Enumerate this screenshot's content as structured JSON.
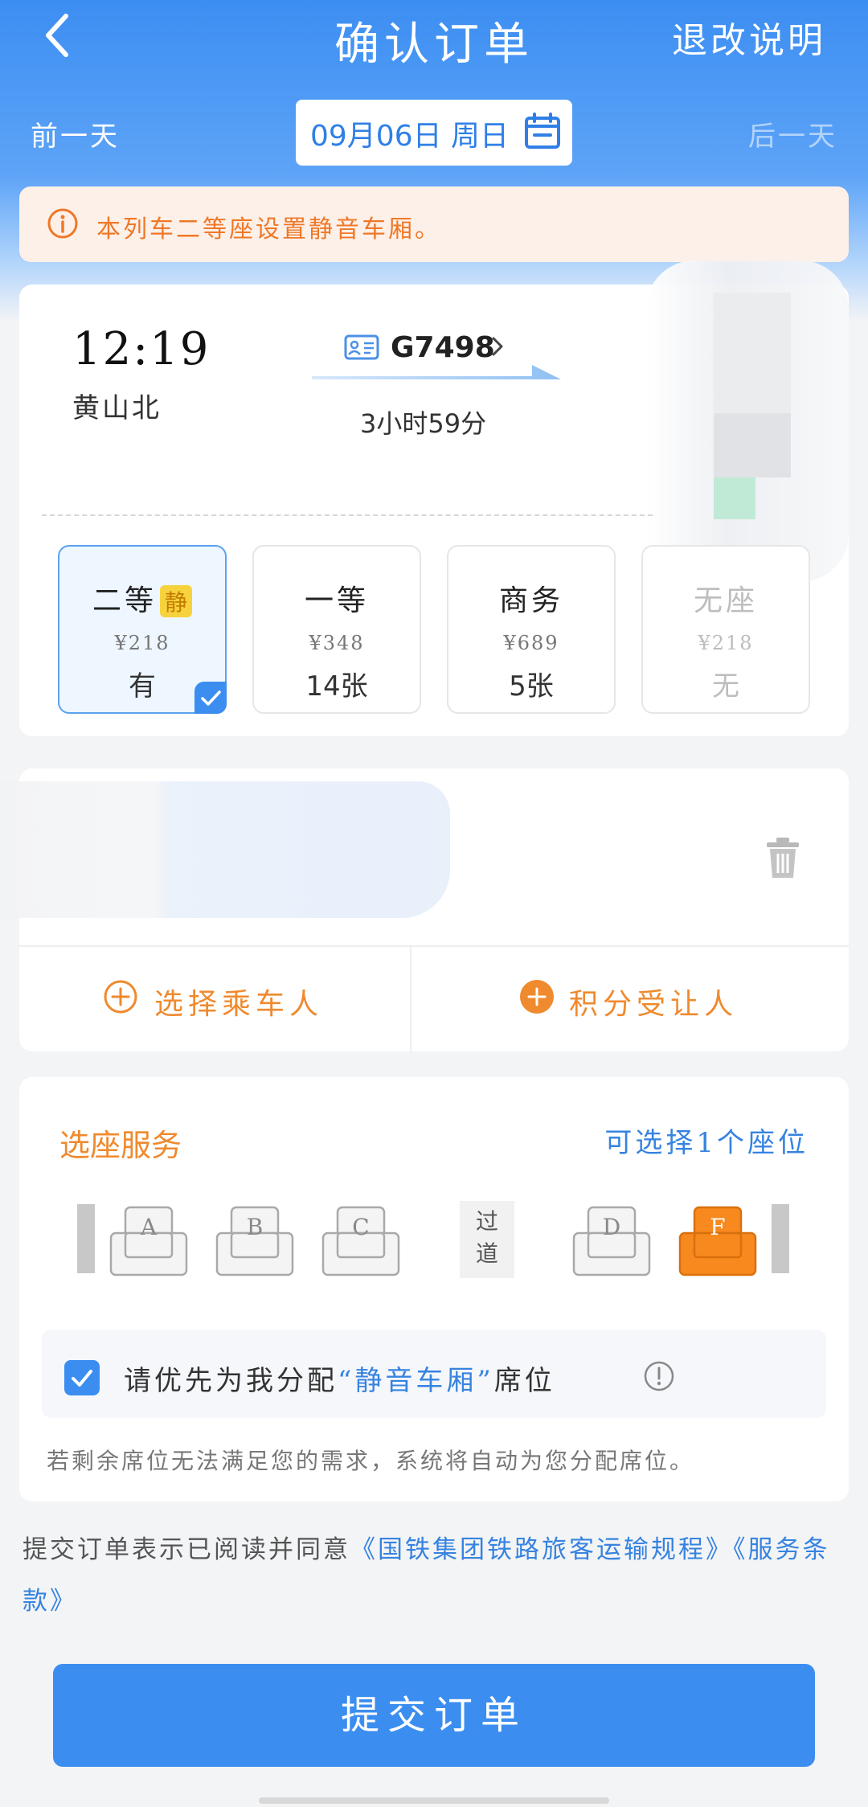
{
  "header": {
    "title": "确认订单",
    "refund_link": "退改说明"
  },
  "date_bar": {
    "prev_day": "前一天",
    "date": "09月06日 周日",
    "next_day": "后一天"
  },
  "notice": {
    "text": "本列车二等座设置静音车厢。"
  },
  "train": {
    "depart_time": "12:19",
    "depart_station": "黄山北",
    "train_no": "G7498",
    "duration": "3小时59分"
  },
  "seat_classes": [
    {
      "name": "二等",
      "tag": "静",
      "price": "¥218",
      "availability": "有",
      "selected": true
    },
    {
      "name": "一等",
      "price": "¥348",
      "availability": "14张"
    },
    {
      "name": "商务",
      "price": "¥689",
      "availability": "5张"
    },
    {
      "name": "无座",
      "price": "¥218",
      "availability": "无",
      "disabled": true
    }
  ],
  "passenger": {
    "choose_label": "选择乘车人",
    "bonus_label": "积分受让人"
  },
  "seat_service": {
    "title": "选座服务",
    "info": "可选择1个座位",
    "seats_left": [
      "A",
      "B",
      "C"
    ],
    "aisle": [
      "过",
      "道"
    ],
    "seats_right": [
      "D",
      "F"
    ],
    "selected_seat": "F",
    "quiet_pref_prefix": "请优先为我分配",
    "quiet_pref_highlight": "“静音车厢”",
    "quiet_pref_suffix": "席位",
    "note": "若剩余席位无法满足您的需求，系统将自动为您分配席位。"
  },
  "agreement": {
    "prefix": "提交订单表示已阅读并同意",
    "link1": "《国铁集团铁路旅客运输规程》",
    "link2": "《服务条款》"
  },
  "submit": {
    "label": "提交订单"
  },
  "colors": {
    "primary_blue": "#3b8ef0",
    "accent_orange": "#ef8a2e",
    "notice_bg": "#fdf0e8",
    "quiet_tag": "#f6d23d"
  }
}
